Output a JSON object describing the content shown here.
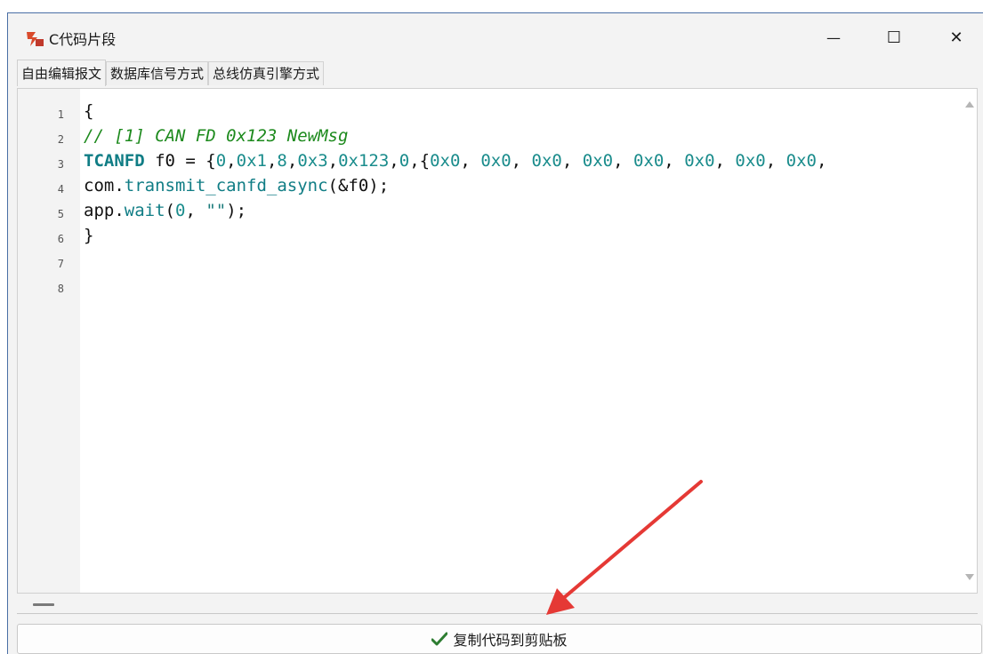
{
  "window": {
    "title": "C代码片段",
    "app_icon": "can-app-icon",
    "controls": {
      "minimize": "—",
      "maximize": "☐",
      "close": "✕"
    }
  },
  "tabs": [
    {
      "label": "自由编辑报文",
      "active": true
    },
    {
      "label": "数据库信号方式",
      "active": false
    },
    {
      "label": "总线仿真引擎方式",
      "active": false
    }
  ],
  "editor": {
    "line_numbers": [
      "1",
      "2",
      "3",
      "4",
      "5",
      "6",
      "7",
      "8"
    ],
    "lines": [
      "{",
      "// [1] CAN FD 0x123 NewMsg",
      "TCANFD f0 = {0,0x1,8,0x3,0x123,0,{0x0, 0x0, 0x0, 0x0, 0x0, 0x0, 0x0, 0x0,",
      "com.transmit_canfd_async(&f0);",
      "app.wait(0, \"\");",
      "}",
      "",
      ""
    ]
  },
  "copy_button": {
    "label": "复制代码到剪贴板",
    "icon": "checkmark-icon"
  },
  "colors": {
    "keyword": "#107d85",
    "comment": "#1d8a1d",
    "annotation_arrow": "#e53935",
    "check": "#2e7d32"
  }
}
